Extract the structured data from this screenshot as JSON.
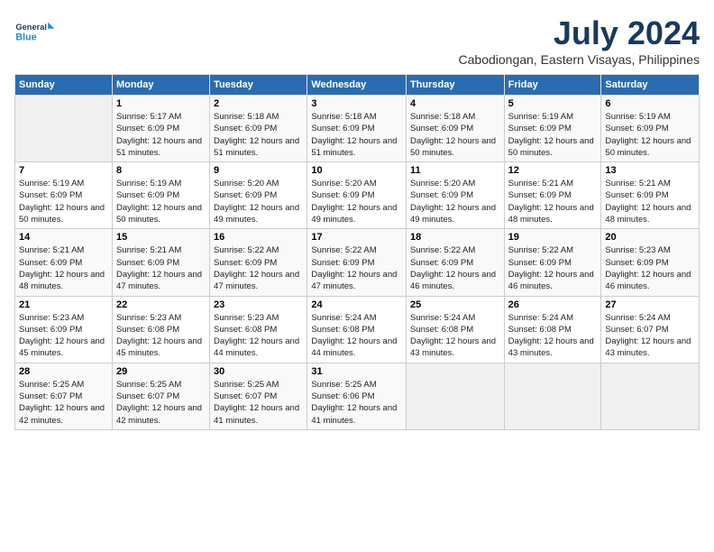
{
  "logo": {
    "line1": "General",
    "line2": "Blue"
  },
  "title": "July 2024",
  "location": "Cabodiongan, Eastern Visayas, Philippines",
  "headers": [
    "Sunday",
    "Monday",
    "Tuesday",
    "Wednesday",
    "Thursday",
    "Friday",
    "Saturday"
  ],
  "weeks": [
    [
      {
        "day": "",
        "sunrise": "",
        "sunset": "",
        "daylight": ""
      },
      {
        "day": "1",
        "sunrise": "Sunrise: 5:17 AM",
        "sunset": "Sunset: 6:09 PM",
        "daylight": "Daylight: 12 hours and 51 minutes."
      },
      {
        "day": "2",
        "sunrise": "Sunrise: 5:18 AM",
        "sunset": "Sunset: 6:09 PM",
        "daylight": "Daylight: 12 hours and 51 minutes."
      },
      {
        "day": "3",
        "sunrise": "Sunrise: 5:18 AM",
        "sunset": "Sunset: 6:09 PM",
        "daylight": "Daylight: 12 hours and 51 minutes."
      },
      {
        "day": "4",
        "sunrise": "Sunrise: 5:18 AM",
        "sunset": "Sunset: 6:09 PM",
        "daylight": "Daylight: 12 hours and 50 minutes."
      },
      {
        "day": "5",
        "sunrise": "Sunrise: 5:19 AM",
        "sunset": "Sunset: 6:09 PM",
        "daylight": "Daylight: 12 hours and 50 minutes."
      },
      {
        "day": "6",
        "sunrise": "Sunrise: 5:19 AM",
        "sunset": "Sunset: 6:09 PM",
        "daylight": "Daylight: 12 hours and 50 minutes."
      }
    ],
    [
      {
        "day": "7",
        "sunrise": "Sunrise: 5:19 AM",
        "sunset": "Sunset: 6:09 PM",
        "daylight": "Daylight: 12 hours and 50 minutes."
      },
      {
        "day": "8",
        "sunrise": "Sunrise: 5:19 AM",
        "sunset": "Sunset: 6:09 PM",
        "daylight": "Daylight: 12 hours and 50 minutes."
      },
      {
        "day": "9",
        "sunrise": "Sunrise: 5:20 AM",
        "sunset": "Sunset: 6:09 PM",
        "daylight": "Daylight: 12 hours and 49 minutes."
      },
      {
        "day": "10",
        "sunrise": "Sunrise: 5:20 AM",
        "sunset": "Sunset: 6:09 PM",
        "daylight": "Daylight: 12 hours and 49 minutes."
      },
      {
        "day": "11",
        "sunrise": "Sunrise: 5:20 AM",
        "sunset": "Sunset: 6:09 PM",
        "daylight": "Daylight: 12 hours and 49 minutes."
      },
      {
        "day": "12",
        "sunrise": "Sunrise: 5:21 AM",
        "sunset": "Sunset: 6:09 PM",
        "daylight": "Daylight: 12 hours and 48 minutes."
      },
      {
        "day": "13",
        "sunrise": "Sunrise: 5:21 AM",
        "sunset": "Sunset: 6:09 PM",
        "daylight": "Daylight: 12 hours and 48 minutes."
      }
    ],
    [
      {
        "day": "14",
        "sunrise": "Sunrise: 5:21 AM",
        "sunset": "Sunset: 6:09 PM",
        "daylight": "Daylight: 12 hours and 48 minutes."
      },
      {
        "day": "15",
        "sunrise": "Sunrise: 5:21 AM",
        "sunset": "Sunset: 6:09 PM",
        "daylight": "Daylight: 12 hours and 47 minutes."
      },
      {
        "day": "16",
        "sunrise": "Sunrise: 5:22 AM",
        "sunset": "Sunset: 6:09 PM",
        "daylight": "Daylight: 12 hours and 47 minutes."
      },
      {
        "day": "17",
        "sunrise": "Sunrise: 5:22 AM",
        "sunset": "Sunset: 6:09 PM",
        "daylight": "Daylight: 12 hours and 47 minutes."
      },
      {
        "day": "18",
        "sunrise": "Sunrise: 5:22 AM",
        "sunset": "Sunset: 6:09 PM",
        "daylight": "Daylight: 12 hours and 46 minutes."
      },
      {
        "day": "19",
        "sunrise": "Sunrise: 5:22 AM",
        "sunset": "Sunset: 6:09 PM",
        "daylight": "Daylight: 12 hours and 46 minutes."
      },
      {
        "day": "20",
        "sunrise": "Sunrise: 5:23 AM",
        "sunset": "Sunset: 6:09 PM",
        "daylight": "Daylight: 12 hours and 46 minutes."
      }
    ],
    [
      {
        "day": "21",
        "sunrise": "Sunrise: 5:23 AM",
        "sunset": "Sunset: 6:09 PM",
        "daylight": "Daylight: 12 hours and 45 minutes."
      },
      {
        "day": "22",
        "sunrise": "Sunrise: 5:23 AM",
        "sunset": "Sunset: 6:08 PM",
        "daylight": "Daylight: 12 hours and 45 minutes."
      },
      {
        "day": "23",
        "sunrise": "Sunrise: 5:23 AM",
        "sunset": "Sunset: 6:08 PM",
        "daylight": "Daylight: 12 hours and 44 minutes."
      },
      {
        "day": "24",
        "sunrise": "Sunrise: 5:24 AM",
        "sunset": "Sunset: 6:08 PM",
        "daylight": "Daylight: 12 hours and 44 minutes."
      },
      {
        "day": "25",
        "sunrise": "Sunrise: 5:24 AM",
        "sunset": "Sunset: 6:08 PM",
        "daylight": "Daylight: 12 hours and 43 minutes."
      },
      {
        "day": "26",
        "sunrise": "Sunrise: 5:24 AM",
        "sunset": "Sunset: 6:08 PM",
        "daylight": "Daylight: 12 hours and 43 minutes."
      },
      {
        "day": "27",
        "sunrise": "Sunrise: 5:24 AM",
        "sunset": "Sunset: 6:07 PM",
        "daylight": "Daylight: 12 hours and 43 minutes."
      }
    ],
    [
      {
        "day": "28",
        "sunrise": "Sunrise: 5:25 AM",
        "sunset": "Sunset: 6:07 PM",
        "daylight": "Daylight: 12 hours and 42 minutes."
      },
      {
        "day": "29",
        "sunrise": "Sunrise: 5:25 AM",
        "sunset": "Sunset: 6:07 PM",
        "daylight": "Daylight: 12 hours and 42 minutes."
      },
      {
        "day": "30",
        "sunrise": "Sunrise: 5:25 AM",
        "sunset": "Sunset: 6:07 PM",
        "daylight": "Daylight: 12 hours and 41 minutes."
      },
      {
        "day": "31",
        "sunrise": "Sunrise: 5:25 AM",
        "sunset": "Sunset: 6:06 PM",
        "daylight": "Daylight: 12 hours and 41 minutes."
      },
      {
        "day": "",
        "sunrise": "",
        "sunset": "",
        "daylight": ""
      },
      {
        "day": "",
        "sunrise": "",
        "sunset": "",
        "daylight": ""
      },
      {
        "day": "",
        "sunrise": "",
        "sunset": "",
        "daylight": ""
      }
    ]
  ]
}
